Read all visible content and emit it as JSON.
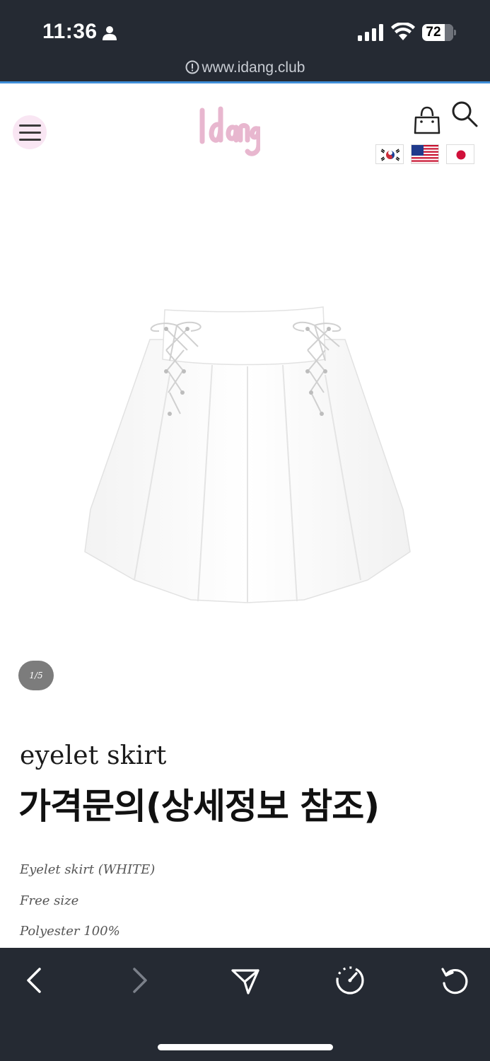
{
  "status_bar": {
    "time": "11:36",
    "battery": "72",
    "battery_level": 0.72
  },
  "browser": {
    "url": "www.idang.club"
  },
  "header": {
    "logo_text": "idang",
    "languages": [
      "Korean",
      "English",
      "Japanese"
    ],
    "accent_color": "#f9e6f3"
  },
  "product": {
    "image_counter": "1/5",
    "name": "eyelet skirt",
    "price": "가격문의(상세정보 참조)",
    "details": [
      "Eyelet skirt (WHITE)",
      "Free size",
      "Polyester 100%"
    ]
  },
  "toolbar": {
    "buttons": [
      "back-icon",
      "forward-icon",
      "share-icon",
      "speed-icon",
      "reload-icon"
    ]
  }
}
